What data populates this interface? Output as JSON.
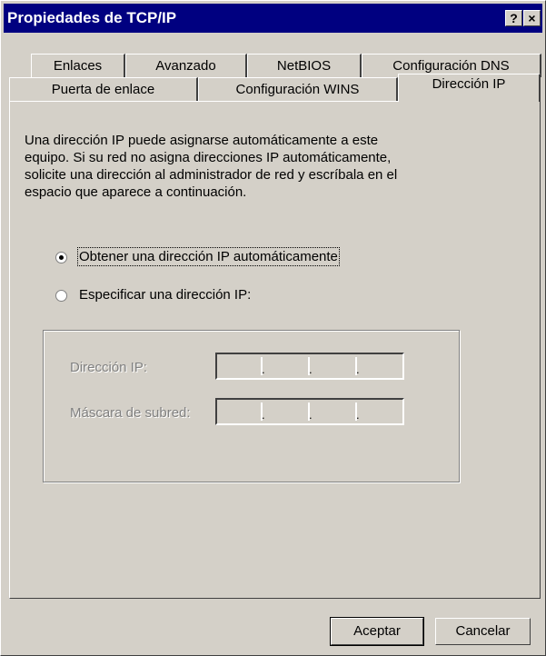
{
  "window": {
    "title": "Propiedades de TCP/IP",
    "help_glyph": "?",
    "close_glyph": "×"
  },
  "tabs": {
    "row1": [
      "Enlaces",
      "Avanzado",
      "NetBIOS",
      "Configuración DNS"
    ],
    "row2": [
      "Puerta de enlace",
      "Configuración WINS",
      "Dirección IP"
    ],
    "active": "Dirección IP"
  },
  "main": {
    "description_lines": [
      "Una dirección IP puede asignarse automáticamente a este",
      "equipo. Si su red no asigna direcciones IP automáticamente,",
      "solicite una dirección al administrador de red y escríbala en el",
      "espacio que aparece a continuación."
    ],
    "radio_auto": {
      "label": "Obtener una dirección IP automáticamente",
      "selected": true
    },
    "radio_manual": {
      "label": "Especificar una dirección IP:",
      "selected": false
    },
    "ip_label": "Dirección IP:",
    "mask_label": "Máscara de subred:",
    "ip_value": "",
    "mask_value": ""
  },
  "buttons": {
    "ok": "Aceptar",
    "cancel": "Cancelar"
  },
  "colors": {
    "title_bar": "#000080",
    "face": "#d4d0c8",
    "disabled_text": "#808080"
  }
}
